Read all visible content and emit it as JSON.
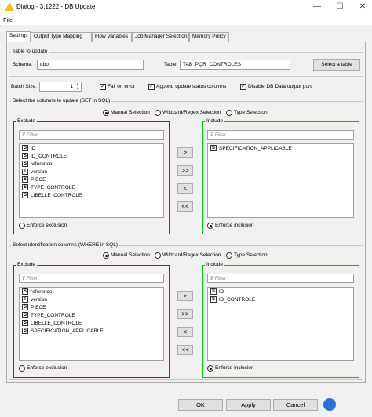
{
  "window": {
    "title": "Dialog - 3:1222 - DB Update",
    "min": "—",
    "max": "☐",
    "close": "✕"
  },
  "menu": {
    "file": "File"
  },
  "tabs": [
    "Settings",
    "Output Type Mapping",
    "Flow Variables",
    "Job Manager Selection",
    "Memory Policy"
  ],
  "table_group": {
    "label": "Table to update",
    "schema_label": "Schema:",
    "schema_value": "dbo",
    "table_label": "Table:",
    "table_value": "TAB_PQR_CONTROLES",
    "select_button": "Select a table"
  },
  "options": {
    "batch_label": "Batch Size:",
    "batch_value": "1",
    "fail_on_error": "Fail on error",
    "append_status": "Append update status columns",
    "disable_output": "Disable DB Data output port"
  },
  "set_section": {
    "label": "Select the columns to update (SET in SQL)",
    "modes": [
      "Manual Selection",
      "Wildcard/Regex Selection",
      "Type Selection"
    ],
    "exclude_label": "Exclude",
    "include_label": "Include",
    "filter_placeholder": "Filter",
    "exclude_items": [
      {
        "type": "S",
        "name": "ID"
      },
      {
        "type": "S",
        "name": "ID_CONTROLE"
      },
      {
        "type": "S",
        "name": "reference"
      },
      {
        "type": "I",
        "name": "version"
      },
      {
        "type": "S",
        "name": "PIECE"
      },
      {
        "type": "S",
        "name": "TYPE_CONTROLE"
      },
      {
        "type": "S",
        "name": "LIBELLE_CONTROLE"
      }
    ],
    "include_items": [
      {
        "type": "S",
        "name": "SPECIFICATION_APPLICABLE"
      }
    ],
    "enforce_exclusion": "Enforce exclusion",
    "enforce_inclusion": "Enforce inclusion"
  },
  "where_section": {
    "label": "Select identification columns (WHERE in SQL)",
    "modes": [
      "Manual Selection",
      "Wildcard/Regex Selection",
      "Type Selection"
    ],
    "exclude_label": "Exclude",
    "include_label": "Include",
    "filter_placeholder": "Filter",
    "exclude_items": [
      {
        "type": "S",
        "name": "reference"
      },
      {
        "type": "I",
        "name": "version"
      },
      {
        "type": "S",
        "name": "PIECE"
      },
      {
        "type": "S",
        "name": "TYPE_CONTROLE"
      },
      {
        "type": "S",
        "name": "LIBELLE_CONTROLE"
      },
      {
        "type": "S",
        "name": "SPECIFICATION_APPLICABLE"
      }
    ],
    "include_items": [
      {
        "type": "S",
        "name": "ID"
      },
      {
        "type": "S",
        "name": "ID_CONTROLE"
      }
    ],
    "enforce_exclusion": "Enforce exclusion",
    "enforce_inclusion": "Enforce inclusion"
  },
  "arrows": {
    "add": ">",
    "add_all": ">>",
    "remove": "<",
    "remove_all": "<<"
  },
  "footer": {
    "ok": "OK",
    "apply": "Apply",
    "cancel": "Cancel"
  },
  "colors": {
    "exclude_border": "#e00000",
    "include_border": "#00c000"
  }
}
